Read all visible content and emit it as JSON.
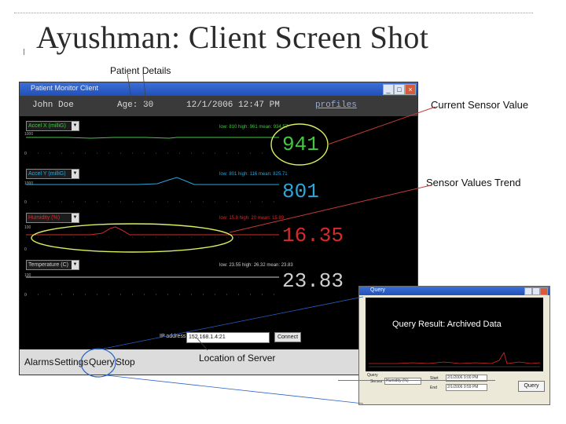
{
  "slide": {
    "title": "Ayushman: Client Screen Shot"
  },
  "callouts": {
    "patient_details": "Patient Details",
    "current_sensor_value": "Current Sensor Value",
    "sensor_values_trend": "Sensor Values Trend",
    "query_result": "Query Result: Archived Data",
    "location_of_server": "Location of Server"
  },
  "app": {
    "window_title": "Patient Monitor Client",
    "header": {
      "patient_name": "John Doe",
      "age": "Age: 30",
      "datetime": "12/1/2006 12:47 PM",
      "profiles_link": "profiles"
    },
    "sensors": [
      {
        "label": "Accel X (milliG)",
        "stats": "low: 810 high: 961 mean: 934.57",
        "value": "941",
        "color": "#43c743",
        "axis_top": "1000",
        "axis_bottom": "0"
      },
      {
        "label": "Accel Y (milliG)",
        "stats": "low: 801 high: 116 mean: 825.71",
        "value": "801",
        "color": "#2fa4d6",
        "axis_top": "1000",
        "axis_bottom": "0"
      },
      {
        "label": "Humidity (%)",
        "stats": "low: 15.8 high: 20 mean: 15.89",
        "value": "16.35",
        "color": "#d82a2a",
        "axis_top": "100",
        "axis_bottom": "0"
      },
      {
        "label": "Temperature (C)",
        "stats": "low: 23.55 high: 26.32 mean: 23.83",
        "value": "23.83",
        "color": "#cfcfcf",
        "axis_top": "100",
        "axis_bottom": "0"
      }
    ],
    "ip_label": "IP address:",
    "ip_value": "152.168.1.4:21",
    "connect_label": "Connect",
    "bottom_buttons": {
      "alarms": "Alarms",
      "settings": "Settings",
      "query": "Query",
      "stop": "Stop"
    }
  },
  "query_window": {
    "title": "Query",
    "section_label": "Query",
    "sensor_label": "Sensor",
    "sensor_value": "Humidity (%)",
    "start_label": "Start",
    "start_value": "2/1/2006 9:00 PM",
    "end_label": "End",
    "end_value": "2/1/2006 9:59 PM",
    "query_button": "Query"
  },
  "colors": {
    "highlight_circle": "#d9f060",
    "accent_line": "#c43a3a",
    "query_circle": "#2a62c8"
  }
}
